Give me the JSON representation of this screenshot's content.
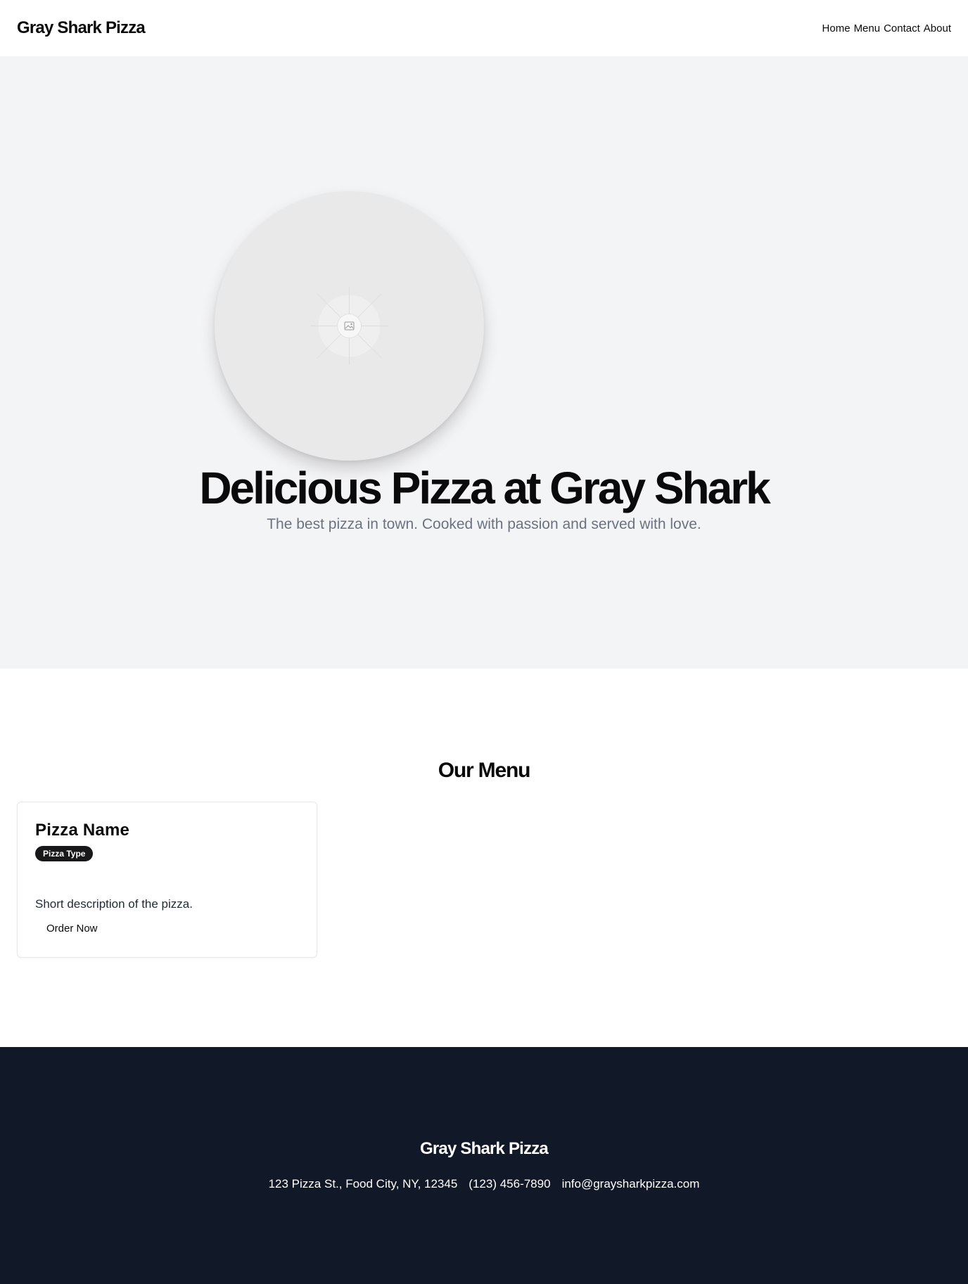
{
  "header": {
    "logo": "Gray Shark Pizza",
    "nav": [
      "Home",
      "Menu",
      "Contact",
      "About"
    ]
  },
  "hero": {
    "image_icon": "image-placeholder-icon",
    "title": "Delicious Pizza at Gray Shark",
    "subtitle": "The best pizza in town. Cooked with passion and served with love."
  },
  "menu": {
    "title": "Our Menu",
    "items": [
      {
        "name": "Pizza Name",
        "type": "Pizza Type",
        "description": "Short description of the pizza.",
        "button": "Order Now"
      }
    ]
  },
  "footer": {
    "title": "Gray Shark Pizza",
    "address": "123 Pizza St., Food City, NY, 12345",
    "phone": "(123) 456-7890",
    "email": "info@graysharkpizza.com"
  },
  "colors": {
    "hero_bg": "#f3f4f6",
    "footer_bg": "#111827",
    "badge_bg": "#18181b",
    "subtitle_text": "#6b7280"
  }
}
